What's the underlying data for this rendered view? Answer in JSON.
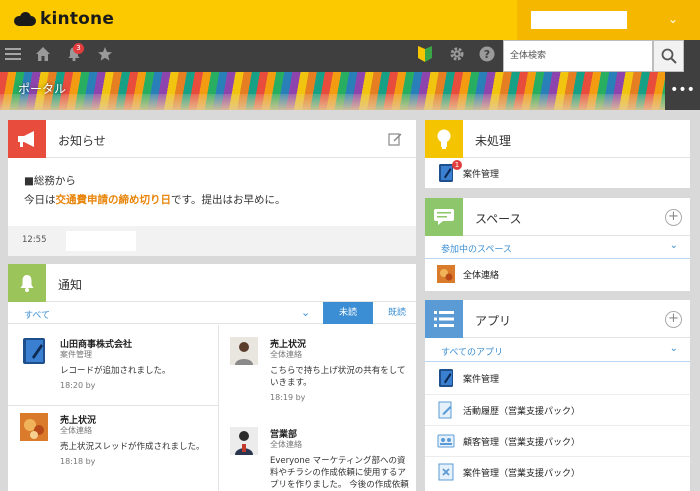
{
  "header": {
    "logo_text": "kintone",
    "notification_count": "3"
  },
  "search": {
    "placeholder": "全体検索"
  },
  "banner": {
    "title": "ポータル",
    "more": "•••"
  },
  "notice": {
    "title": "お知らせ",
    "line1": "■総務から",
    "line2_before": "今日は",
    "line2_highlight": "交通費申請の締め切り日",
    "line2_after": "です。提出はお早めに。",
    "time": "12:55"
  },
  "notifications": {
    "title": "通知",
    "filter_label": "すべて",
    "tab_unread": "未読",
    "tab_read": "既読",
    "items": [
      {
        "title": "山田商事株式会社",
        "sub": "案件管理",
        "text": "レコードが追加されました。",
        "meta": "18:20  by"
      },
      {
        "title": "売上状況",
        "sub": "全体連絡",
        "text": "こちらで持ち上げ状況の共有をしていきます。",
        "meta": "18:19  by"
      },
      {
        "title": "売上状況",
        "sub": "全体連絡",
        "text": "売上状況スレッドが作成されました。",
        "meta": "18:18  by"
      },
      {
        "title": "営業部",
        "sub": "全体連絡",
        "text": "Everyone マーケティング部への資料やチラシの作成依頼に使用するアプリを作りました。 今後の作成依頼に",
        "meta": ""
      }
    ]
  },
  "pending": {
    "title": "未処理",
    "badge": "1",
    "items": [
      {
        "label": "案件管理"
      }
    ]
  },
  "spaces": {
    "title": "スペース",
    "filter_label": "参加中のスペース",
    "items": [
      {
        "label": "全体連絡"
      }
    ]
  },
  "apps": {
    "title": "アプリ",
    "filter_label": "すべてのアプリ",
    "items": [
      {
        "label": "案件管理"
      },
      {
        "label": "活動履歴（営業支援パック）"
      },
      {
        "label": "顧客管理（営業支援パック）"
      },
      {
        "label": "案件管理（営業支援パック）"
      }
    ]
  },
  "colors": {
    "brand_yellow": "#fcc800",
    "nav_dark": "#3f3f3f",
    "link_blue": "#3b8ed3",
    "notice_red": "#e84c3d",
    "notif_green": "#9bc55a",
    "pending_yellow": "#f5c400",
    "space_green": "#8ec66b",
    "apps_blue": "#5b9bd5",
    "highlight_orange": "#e8850a"
  }
}
